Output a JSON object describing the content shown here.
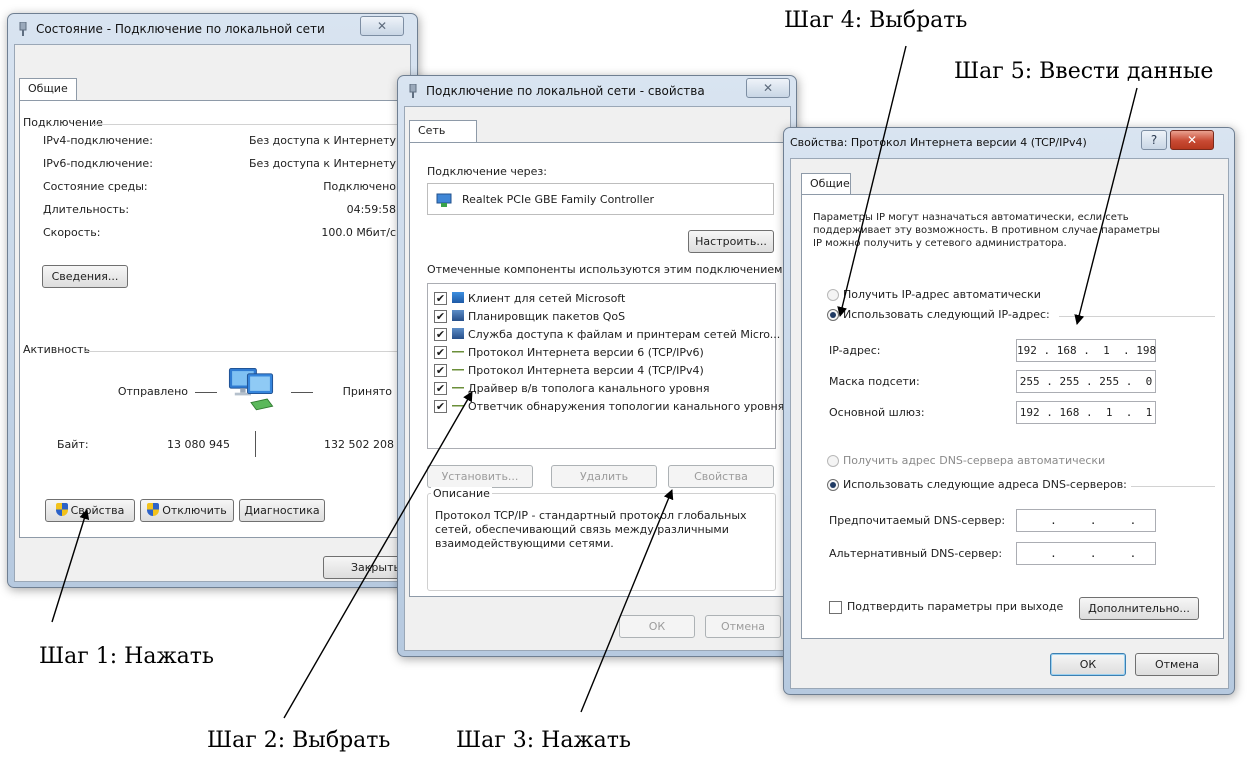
{
  "status_dialog": {
    "title": "Состояние - Подключение по локальной сети",
    "close_glyph": "✕",
    "tab_general": "Общие",
    "connection_group": "Подключение",
    "rows": [
      {
        "label": "IPv4-подключение:",
        "value": "Без доступа к Интернету"
      },
      {
        "label": "IPv6-подключение:",
        "value": "Без доступа к Интернету"
      },
      {
        "label": "Состояние среды:",
        "value": "Подключено"
      },
      {
        "label": "Длительность:",
        "value": "04:59:58"
      },
      {
        "label": "Скорость:",
        "value": "100.0 Мбит/с"
      }
    ],
    "details_button": "Сведения...",
    "activity_group": "Активность",
    "sent_label": "Отправлено",
    "received_label": "Принято",
    "bytes_label": "Байт:",
    "bytes_sent": "13 080 945",
    "bytes_received": "132 502 208",
    "properties_button": "Свойства",
    "disable_button": "Отключить",
    "diagnostics_button": "Диагностика",
    "close_button": "Закрыть"
  },
  "properties_dialog": {
    "title": "Подключение по локальной сети - свойства",
    "close_glyph": "✕",
    "tab_network": "Сеть",
    "connect_using_label": "Подключение через:",
    "adapter_name": "Realtek PCIe GBE Family Controller",
    "configure_button": "Настроить...",
    "components_label": "Отмеченные компоненты используются этим подключением:",
    "components": [
      {
        "label": "Клиент для сетей Microsoft",
        "checked": true,
        "icon": "network-client-icon"
      },
      {
        "label": "Планировщик пакетов QoS",
        "checked": true,
        "icon": "service-icon"
      },
      {
        "label": "Служба доступа к файлам и принтерам сетей Micro...",
        "checked": true,
        "icon": "service-icon"
      },
      {
        "label": "Протокол Интернета версии 6 (TCP/IPv6)",
        "checked": true,
        "icon": "protocol-icon"
      },
      {
        "label": "Протокол Интернета версии 4 (TCP/IPv4)",
        "checked": true,
        "icon": "protocol-icon"
      },
      {
        "label": "Драйвер в/в тополога канального уровня",
        "checked": true,
        "icon": "protocol-icon"
      },
      {
        "label": "Ответчик обнаружения топологии канального уровня",
        "checked": true,
        "icon": "protocol-icon"
      }
    ],
    "install_button": "Установить...",
    "uninstall_button": "Удалить",
    "properties_button": "Свойства",
    "description_label": "Описание",
    "description_text": [
      "Протокол TCP/IP - стандартный протокол глобальных",
      "сетей, обеспечивающий связь между различными",
      "взаимодействующими сетями."
    ],
    "ok_button": "ОК",
    "cancel_button": "Отмена"
  },
  "ipv4_dialog": {
    "title": "Свойства: Протокол Интернета версии 4 (TCP/IPv4)",
    "help_glyph": "?",
    "close_glyph": "✕",
    "tab_general": "Общие",
    "intro_text": [
      "Параметры IP могут назначаться автоматически, если сеть",
      "поддерживает эту возможность. В противном случае параметры",
      "IP можно получить у сетевого администратора."
    ],
    "auto_ip_radio": "Получить IP-адрес автоматически",
    "manual_ip_radio": "Использовать следующий IP-адрес:",
    "ip_label": "IP-адрес:",
    "ip_value": "192 . 168 .  1  . 198",
    "mask_label": "Маска подсети:",
    "mask_value": "255 . 255 . 255 .  0",
    "gateway_label": "Основной шлюз:",
    "gateway_value": "192 . 168 .  1  .  1",
    "auto_dns_radio": "Получить адрес DNS-сервера автоматически",
    "manual_dns_radio": "Использовать следующие адреса DNS-серверов:",
    "preferred_dns_label": "Предпочитаемый DNS-сервер:",
    "preferred_dns_value": "     .     .     .     ",
    "alternate_dns_label": "Альтернативный DNS-сервер:",
    "alternate_dns_value": "     .     .     .     ",
    "validate_checkbox": "Подтвердить параметры при выходе",
    "advanced_button": "Дополнительно...",
    "ok_button": "ОК",
    "cancel_button": "Отмена"
  },
  "annotations": {
    "step1": "Шаг 1: Нажать",
    "step2": "Шаг 2: Выбрать",
    "step3": "Шаг 3: Нажать",
    "step4": "Шаг 4: Выбрать",
    "step5": "Шаг 5: Ввести данные"
  }
}
